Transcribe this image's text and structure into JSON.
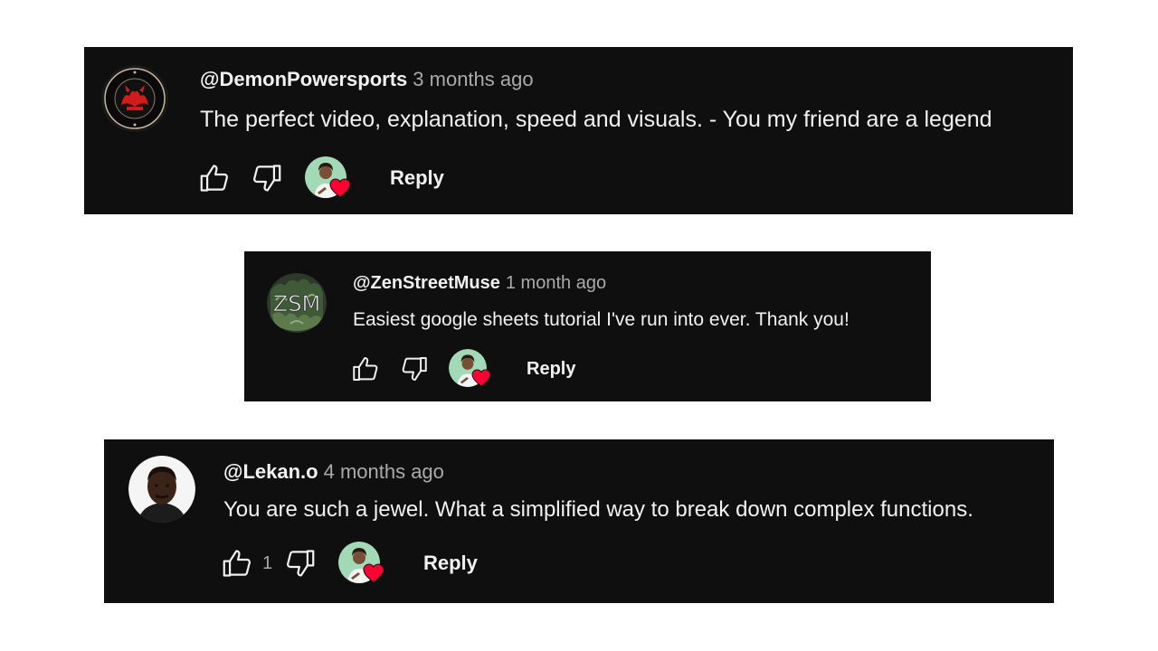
{
  "comments": [
    {
      "handle": "@DemonPowersports",
      "time": "3 months ago",
      "text": "The perfect video, explanation, speed and visuals. - You my friend are a legend",
      "like_count": "",
      "reply_label": "Reply",
      "avatar_icon": "demon-powersports-logo-icon",
      "hearted_by_creator": true
    },
    {
      "handle": "@ZenStreetMuse",
      "time": "1 month ago",
      "text": "Easiest google sheets tutorial I've run into ever. Thank you!",
      "like_count": "",
      "reply_label": "Reply",
      "avatar_icon": "zsm-logo-icon",
      "avatar_text": "ZSM",
      "hearted_by_creator": true
    },
    {
      "handle": "@Lekan.o",
      "time": "4 months ago",
      "text": "You are such a jewel. What a simplified way to break down complex functions.",
      "like_count": "1",
      "reply_label": "Reply",
      "avatar_icon": "user-photo-icon",
      "hearted_by_creator": true
    }
  ],
  "colors": {
    "card_background": "#0f0f0f",
    "page_background": "#ffffff",
    "primary_text": "#f1f1f1",
    "secondary_text": "#aaaaaa",
    "heart": "#ff0033"
  }
}
